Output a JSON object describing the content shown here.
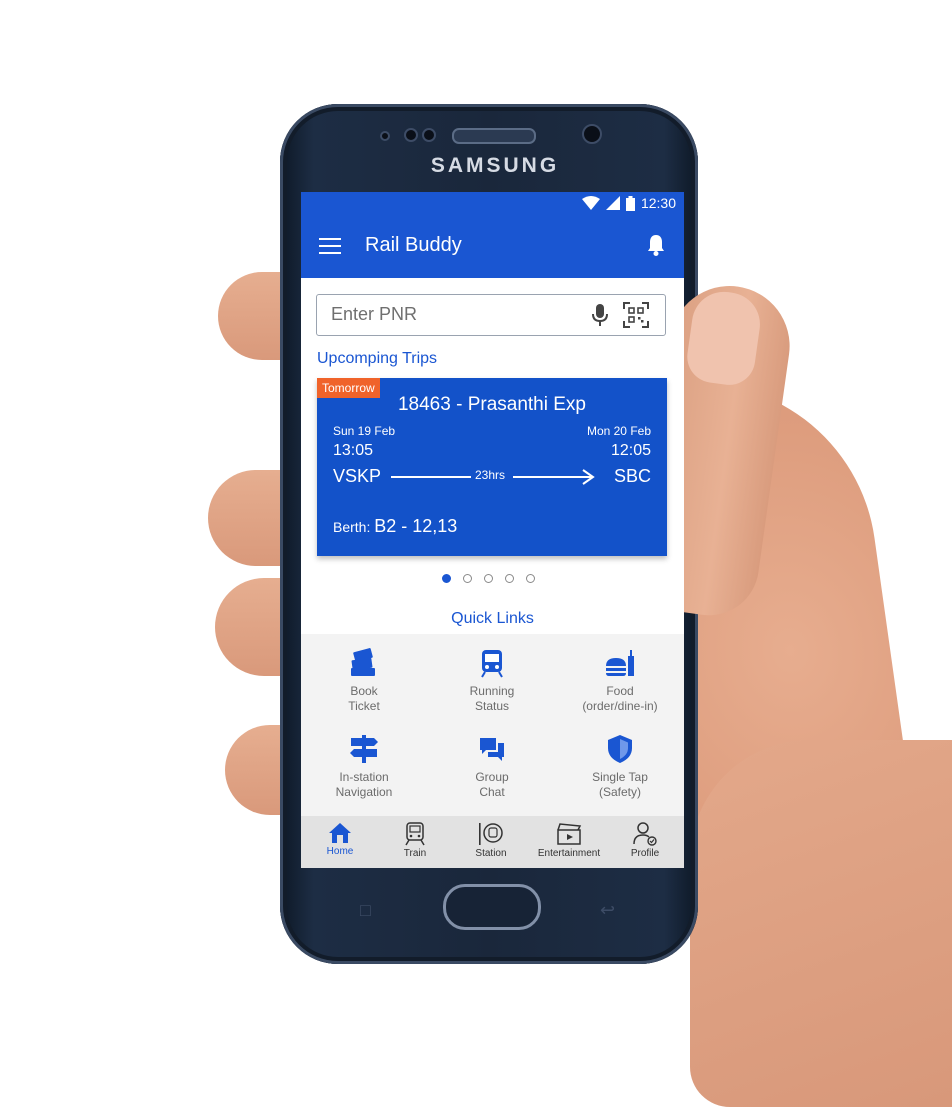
{
  "device": {
    "brand": "SAMSUNG"
  },
  "status_bar": {
    "time": "12:30"
  },
  "app_bar": {
    "title": "Rail Buddy"
  },
  "search": {
    "placeholder": "Enter PNR",
    "value": ""
  },
  "upcoming": {
    "title": "Upcomping Trips",
    "trip": {
      "badge": "Tomorrow",
      "train": "18463 - Prasanthi Exp",
      "from": {
        "date": "Sun 19 Feb",
        "time": "13:05",
        "code": "VSKP"
      },
      "to": {
        "date": "Mon 20 Feb",
        "time": "12:05",
        "code": "SBC"
      },
      "duration": "23hrs",
      "berth_label": "Berth:",
      "berth_value": "B2 - 12,13"
    },
    "pagination": {
      "count": 5,
      "active_index": 0
    }
  },
  "quick_links": {
    "title": "Quick Links",
    "items": [
      {
        "line1": "Book",
        "line2": "Ticket",
        "icon": "tickets-icon"
      },
      {
        "line1": "Running",
        "line2": "Status",
        "icon": "train-front-icon"
      },
      {
        "line1": "Food",
        "line2": "(order/dine-in)",
        "icon": "food-icon"
      },
      {
        "line1": "In-station",
        "line2": "Navigation",
        "icon": "signpost-icon"
      },
      {
        "line1": "Group",
        "line2": "Chat",
        "icon": "chat-icon"
      },
      {
        "line1": "Single Tap",
        "line2": "(Safety)",
        "icon": "shield-icon"
      }
    ]
  },
  "bottom_nav": {
    "items": [
      {
        "label": "Home",
        "icon": "home-icon",
        "active": true
      },
      {
        "label": "Train",
        "icon": "train-icon",
        "active": false
      },
      {
        "label": "Station",
        "icon": "station-icon",
        "active": false
      },
      {
        "label": "Entertainment",
        "icon": "clapperboard-icon",
        "active": false
      },
      {
        "label": "Profile",
        "icon": "profile-icon",
        "active": false
      }
    ]
  },
  "colors": {
    "primary": "#1a56d2",
    "card": "#1352c9",
    "badge": "#f0632a",
    "grid_bg": "#f3f3f3",
    "nav_bg": "#e2e2e2"
  }
}
